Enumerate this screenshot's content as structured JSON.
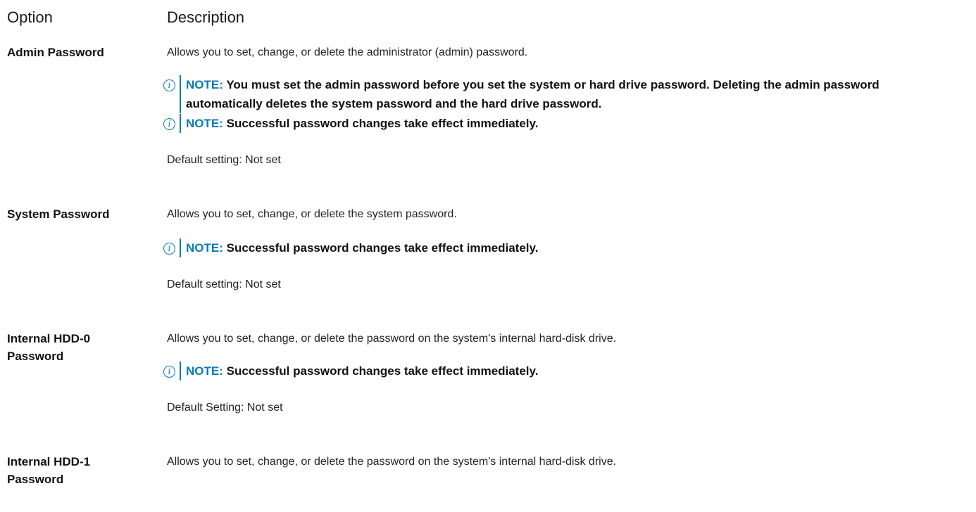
{
  "header": {
    "option": "Option",
    "description": "Description"
  },
  "note_label": "NOTE:",
  "note_icon_glyph": "i",
  "accent_color": "#0a7ab5",
  "rows": [
    {
      "option": "Admin Password",
      "description": "Allows you to set, change, or delete the administrator (admin) password.",
      "notes": [
        "You must set the admin password before you set the system or hard drive password. Deleting the admin password automatically deletes the system password and the hard drive password.",
        "Successful password changes take effect immediately."
      ],
      "default": "Default setting: Not set"
    },
    {
      "option": "System Password",
      "description": "Allows you to set, change, or delete the system password.",
      "notes": [
        "Successful password changes take effect immediately."
      ],
      "default": "Default setting: Not set"
    },
    {
      "option": "Internal HDD-0 Password",
      "description": "Allows you to set, change, or delete the password on the system's internal hard-disk drive.",
      "notes": [
        "Successful password changes take effect immediately."
      ],
      "default": "Default Setting: Not set"
    },
    {
      "option": "Internal HDD-1 Password",
      "description": "Allows you to set, change, or delete the password on the system's internal hard-disk drive.",
      "notes": [],
      "default": ""
    }
  ]
}
